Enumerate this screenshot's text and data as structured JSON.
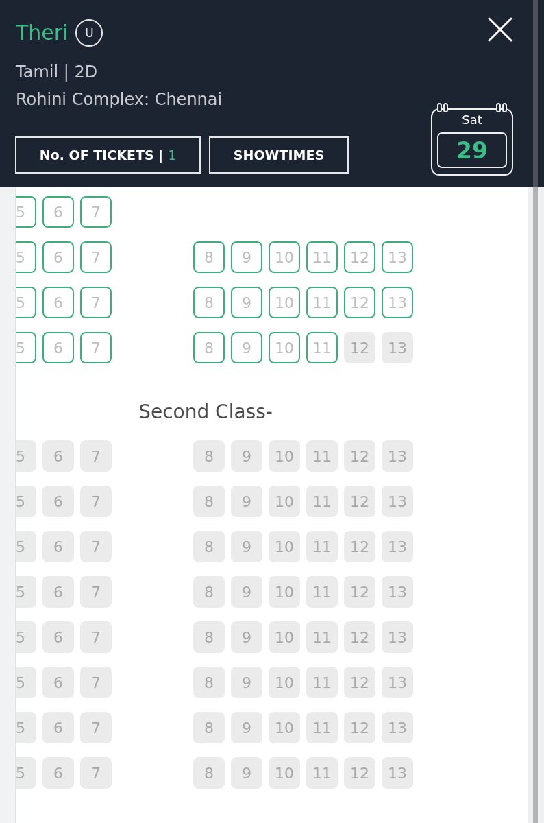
{
  "movie": {
    "title": "Theri",
    "certificate": "U",
    "format": "Tamil | 2D",
    "venue": "Rohini Complex: Chennai"
  },
  "tickets_button": {
    "label": "No. OF TICKETS |",
    "count": "1"
  },
  "showtimes_button": {
    "label": "SHOWTIMES"
  },
  "date": {
    "day": "Sat",
    "number": "29"
  },
  "sections": [
    {
      "rows": [
        {
          "left": [
            {
              "label": "5",
              "available": true
            },
            {
              "label": "6",
              "available": true
            },
            {
              "label": "7",
              "available": true
            }
          ]
        },
        {
          "left": [
            {
              "label": "5",
              "available": true
            },
            {
              "label": "6",
              "available": true
            },
            {
              "label": "7",
              "available": true
            }
          ],
          "right": [
            {
              "label": "8",
              "available": true
            },
            {
              "label": "9",
              "available": true
            },
            {
              "label": "10",
              "available": true
            },
            {
              "label": "11",
              "available": true
            },
            {
              "label": "12",
              "available": true
            },
            {
              "label": "13",
              "available": true
            }
          ]
        },
        {
          "left": [
            {
              "label": "5",
              "available": true
            },
            {
              "label": "6",
              "available": true
            },
            {
              "label": "7",
              "available": true
            }
          ],
          "right": [
            {
              "label": "8",
              "available": true
            },
            {
              "label": "9",
              "available": true
            },
            {
              "label": "10",
              "available": true
            },
            {
              "label": "11",
              "available": true
            },
            {
              "label": "12",
              "available": true
            },
            {
              "label": "13",
              "available": true
            }
          ]
        },
        {
          "left": [
            {
              "label": "5",
              "available": true
            },
            {
              "label": "6",
              "available": true
            },
            {
              "label": "7",
              "available": true
            }
          ],
          "right": [
            {
              "label": "8",
              "available": true
            },
            {
              "label": "9",
              "available": true
            },
            {
              "label": "10",
              "available": true
            },
            {
              "label": "11",
              "available": true
            },
            {
              "label": "12",
              "available": false
            },
            {
              "label": "13",
              "available": false
            }
          ]
        }
      ]
    },
    {
      "title": "Second Class-",
      "rows": [
        {
          "left": [
            {
              "label": "5",
              "available": false
            },
            {
              "label": "6",
              "available": false
            },
            {
              "label": "7",
              "available": false
            }
          ],
          "right": [
            {
              "label": "8",
              "available": false
            },
            {
              "label": "9",
              "available": false
            },
            {
              "label": "10",
              "available": false
            },
            {
              "label": "11",
              "available": false
            },
            {
              "label": "12",
              "available": false
            },
            {
              "label": "13",
              "available": false
            }
          ]
        },
        {
          "left": [
            {
              "label": "5",
              "available": false
            },
            {
              "label": "6",
              "available": false
            },
            {
              "label": "7",
              "available": false
            }
          ],
          "right": [
            {
              "label": "8",
              "available": false
            },
            {
              "label": "9",
              "available": false
            },
            {
              "label": "10",
              "available": false
            },
            {
              "label": "11",
              "available": false
            },
            {
              "label": "12",
              "available": false
            },
            {
              "label": "13",
              "available": false
            }
          ]
        },
        {
          "left": [
            {
              "label": "5",
              "available": false
            },
            {
              "label": "6",
              "available": false
            },
            {
              "label": "7",
              "available": false
            }
          ],
          "right": [
            {
              "label": "8",
              "available": false
            },
            {
              "label": "9",
              "available": false
            },
            {
              "label": "10",
              "available": false
            },
            {
              "label": "11",
              "available": false
            },
            {
              "label": "12",
              "available": false
            },
            {
              "label": "13",
              "available": false
            }
          ]
        },
        {
          "left": [
            {
              "label": "5",
              "available": false
            },
            {
              "label": "6",
              "available": false
            },
            {
              "label": "7",
              "available": false
            }
          ],
          "right": [
            {
              "label": "8",
              "available": false
            },
            {
              "label": "9",
              "available": false
            },
            {
              "label": "10",
              "available": false
            },
            {
              "label": "11",
              "available": false
            },
            {
              "label": "12",
              "available": false
            },
            {
              "label": "13",
              "available": false
            }
          ]
        },
        {
          "left": [
            {
              "label": "5",
              "available": false
            },
            {
              "label": "6",
              "available": false
            },
            {
              "label": "7",
              "available": false
            }
          ],
          "right": [
            {
              "label": "8",
              "available": false
            },
            {
              "label": "9",
              "available": false
            },
            {
              "label": "10",
              "available": false
            },
            {
              "label": "11",
              "available": false
            },
            {
              "label": "12",
              "available": false
            },
            {
              "label": "13",
              "available": false
            }
          ]
        },
        {
          "left": [
            {
              "label": "5",
              "available": false
            },
            {
              "label": "6",
              "available": false
            },
            {
              "label": "7",
              "available": false
            }
          ],
          "right": [
            {
              "label": "8",
              "available": false
            },
            {
              "label": "9",
              "available": false
            },
            {
              "label": "10",
              "available": false
            },
            {
              "label": "11",
              "available": false
            },
            {
              "label": "12",
              "available": false
            },
            {
              "label": "13",
              "available": false
            }
          ]
        },
        {
          "left": [
            {
              "label": "5",
              "available": false
            },
            {
              "label": "6",
              "available": false
            },
            {
              "label": "7",
              "available": false
            }
          ],
          "right": [
            {
              "label": "8",
              "available": false
            },
            {
              "label": "9",
              "available": false
            },
            {
              "label": "10",
              "available": false
            },
            {
              "label": "11",
              "available": false
            },
            {
              "label": "12",
              "available": false
            },
            {
              "label": "13",
              "available": false
            }
          ]
        },
        {
          "left": [
            {
              "label": "5",
              "available": false
            },
            {
              "label": "6",
              "available": false
            },
            {
              "label": "7",
              "available": false
            }
          ],
          "right": [
            {
              "label": "8",
              "available": false
            },
            {
              "label": "9",
              "available": false
            },
            {
              "label": "10",
              "available": false
            },
            {
              "label": "11",
              "available": false
            },
            {
              "label": "12",
              "available": false
            },
            {
              "label": "13",
              "available": false
            }
          ]
        }
      ]
    }
  ]
}
